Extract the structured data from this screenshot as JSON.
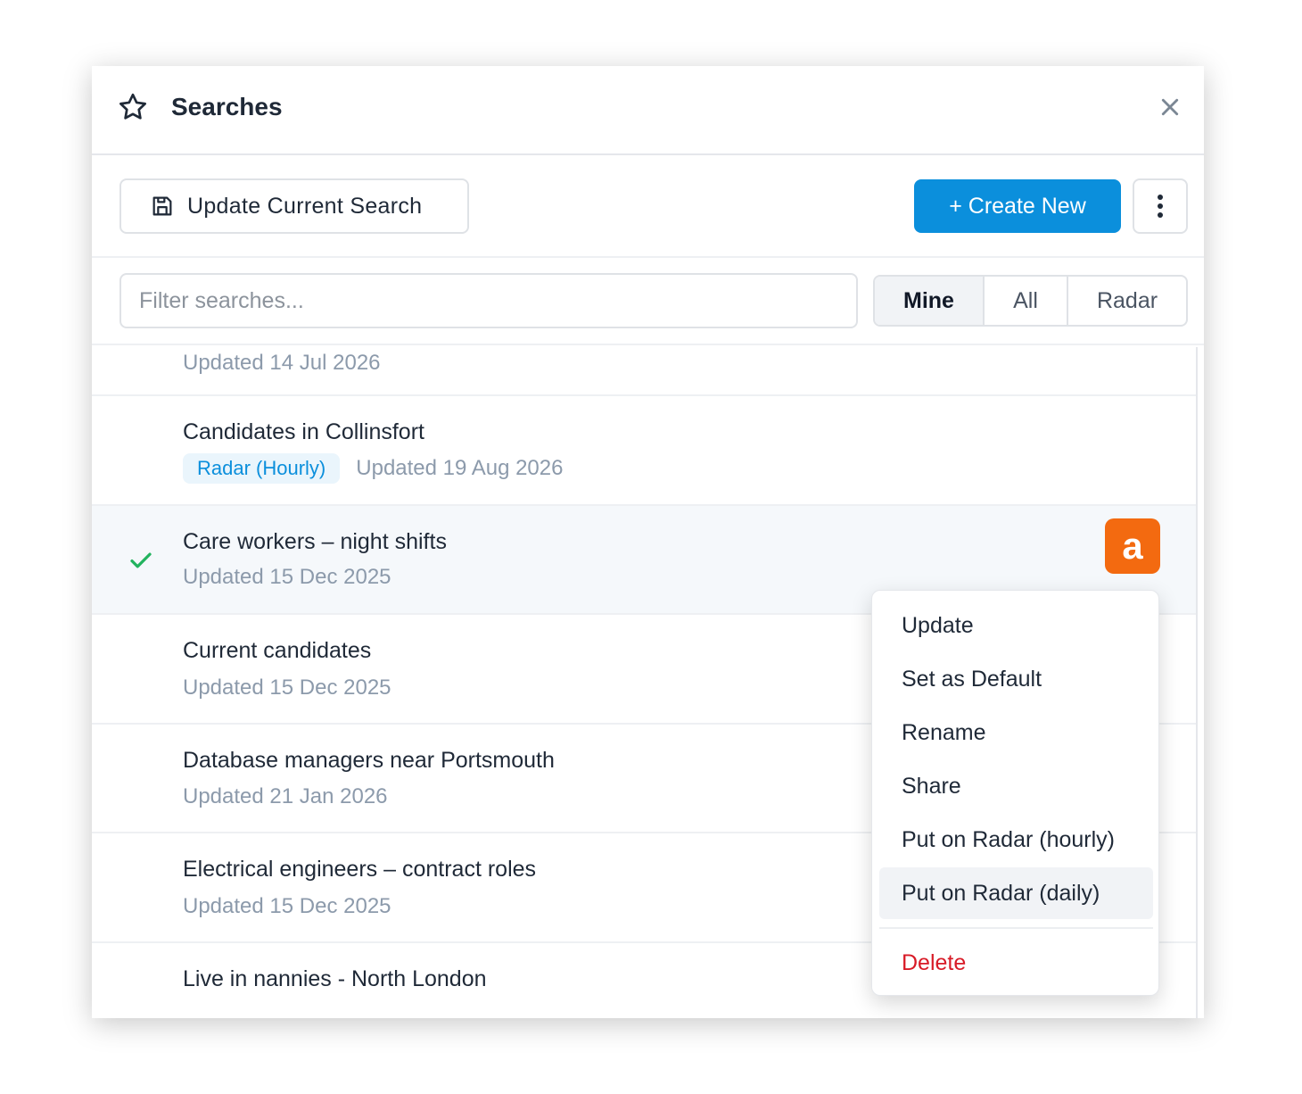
{
  "header": {
    "title": "Searches"
  },
  "toolbar": {
    "update_label": "Update Current Search",
    "create_label": "+ Create New"
  },
  "filter": {
    "placeholder": "Filter searches...",
    "tabs": [
      "Mine",
      "All",
      "Radar"
    ],
    "active_tab": "Mine"
  },
  "list": {
    "partial_row_sub": "Updated 14 Jul 2026",
    "rows": [
      {
        "title": "Candidates in Collinsfort",
        "badge": "Radar (Hourly)",
        "updated": "Updated 19 Aug 2026"
      },
      {
        "title": "Care workers – night shifts",
        "updated": "Updated 15 Dec 2025",
        "selected": true,
        "avatar": "a"
      },
      {
        "title": "Current candidates",
        "updated": "Updated 15 Dec 2025"
      },
      {
        "title": "Database managers near Portsmouth",
        "updated": "Updated 21 Jan 2026"
      },
      {
        "title": "Electrical engineers – contract roles",
        "updated": "Updated 15 Dec 2025"
      },
      {
        "title": "Live in nannies - North London"
      }
    ]
  },
  "menu": {
    "items": [
      "Update",
      "Set as Default",
      "Rename",
      "Share",
      "Put on Radar (hourly)",
      "Put on Radar (daily)"
    ],
    "hovered": "Put on Radar (daily)",
    "danger_item": "Delete"
  },
  "colors": {
    "primary": "#0b8fdc",
    "avatar": "#f36a10",
    "danger": "#d81b27",
    "check": "#22b35e"
  }
}
